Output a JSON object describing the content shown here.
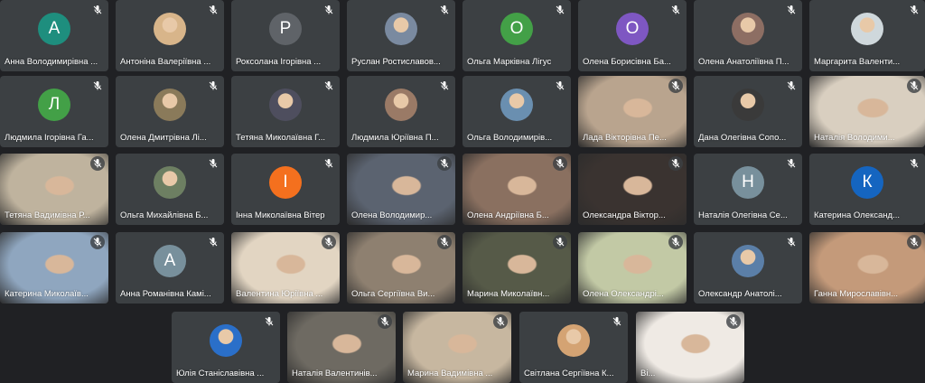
{
  "colors": {
    "background": "#202124",
    "tile": "#3c4043"
  },
  "participants": [
    {
      "name": "Анна Володимирівна ...",
      "initial": "А",
      "avatar": "letter",
      "color": "#1e8e7e"
    },
    {
      "name": "Антоніна Валеріївна ...",
      "avatar": "photo",
      "color": "#d8b58a"
    },
    {
      "name": "Роксолана Ігорівна ...",
      "initial": "Р",
      "avatar": "letter",
      "color": "#5f6368"
    },
    {
      "name": "Руслан Ростиславов...",
      "avatar": "photo",
      "color": "#7a8aa0"
    },
    {
      "name": "Ольга Марківна Лігус",
      "initial": "О",
      "avatar": "letter",
      "color": "#43a047"
    },
    {
      "name": "Олена Борисівна Ба...",
      "initial": "О",
      "avatar": "letter",
      "color": "#7e57c2"
    },
    {
      "name": "Олена Анатоліївна П...",
      "avatar": "photo",
      "color": "#8d6e63"
    },
    {
      "name": "Маргарита Валенти...",
      "avatar": "photo",
      "color": "#cfd8dc"
    },
    {
      "name": "Людмила Ігорівна Га...",
      "initial": "Л",
      "avatar": "letter",
      "color": "#43a047"
    },
    {
      "name": "Олена Дмитрівна Лі...",
      "avatar": "photo",
      "color": "#8a7a5a"
    },
    {
      "name": "Тетяна Миколаївна Г...",
      "avatar": "photo",
      "color": "#4e4e5e"
    },
    {
      "name": "Людмила Юріївна П...",
      "avatar": "photo",
      "color": "#9a7a66"
    },
    {
      "name": "Ольга Володимирів...",
      "avatar": "photo",
      "color": "#6a8fb0"
    },
    {
      "name": "Лада Вікторівна Пе...",
      "avatar": "video",
      "color": "#b9a48e"
    },
    {
      "name": "Дана Олегівна Сопо...",
      "avatar": "photo",
      "color": "#3a3a3a"
    },
    {
      "name": "Наталія Володими...",
      "avatar": "video",
      "color": "#d9cfc0"
    },
    {
      "name": "Тетяна Вадимівна Р...",
      "avatar": "video",
      "color": "#bfb39e"
    },
    {
      "name": "Ольга Михайлівна Б...",
      "avatar": "photo",
      "color": "#6d7f62"
    },
    {
      "name": "Інна Миколаївна Вітер",
      "initial": "І",
      "avatar": "letter",
      "color": "#f4701e"
    },
    {
      "name": "Олена Володимир...",
      "avatar": "video",
      "color": "#5b6370"
    },
    {
      "name": "Олена Андріївна Б...",
      "avatar": "video",
      "color": "#8a7060"
    },
    {
      "name": "Олександра Віктор...",
      "avatar": "video",
      "color": "#3a3330"
    },
    {
      "name": "Наталія Олегівна Се...",
      "initial": "Н",
      "avatar": "letter",
      "color": "#78909c"
    },
    {
      "name": "Катерина Олександ...",
      "initial": "К",
      "avatar": "letter",
      "color": "#1565c0"
    },
    {
      "name": "Катерина Миколаїв...",
      "avatar": "video",
      "color": "#8fa6bf"
    },
    {
      "name": "Анна Романівна Камі...",
      "initial": "А",
      "avatar": "letter",
      "color": "#78909c"
    },
    {
      "name": "Валентина Юріївна ...",
      "avatar": "video",
      "color": "#e2d5c2"
    },
    {
      "name": "Ольга Сергіївна Ви...",
      "avatar": "video",
      "color": "#8e8070"
    },
    {
      "name": "Марина Миколаївн...",
      "avatar": "video",
      "color": "#565a48"
    },
    {
      "name": "Олена Олександрі...",
      "avatar": "video",
      "color": "#c2c9a5"
    },
    {
      "name": "Олександр Анатолі...",
      "avatar": "photo",
      "color": "#5b7fa8"
    },
    {
      "name": "Ганна Мирославівн...",
      "avatar": "video",
      "color": "#c49a7a"
    },
    {
      "name": "Юлія Станіславівна ...",
      "avatar": "photo",
      "color": "#2a6fc9"
    },
    {
      "name": "Наталія Валентинів...",
      "avatar": "video",
      "color": "#6e6a62"
    },
    {
      "name": "Марина Вадимівна ...",
      "avatar": "video",
      "color": "#c7b7a0"
    },
    {
      "name": "Світлана Сергіївна К...",
      "avatar": "photo",
      "color": "#d4a373"
    },
    {
      "name": "Ві...",
      "avatar": "video",
      "color": "#efeae4"
    }
  ]
}
